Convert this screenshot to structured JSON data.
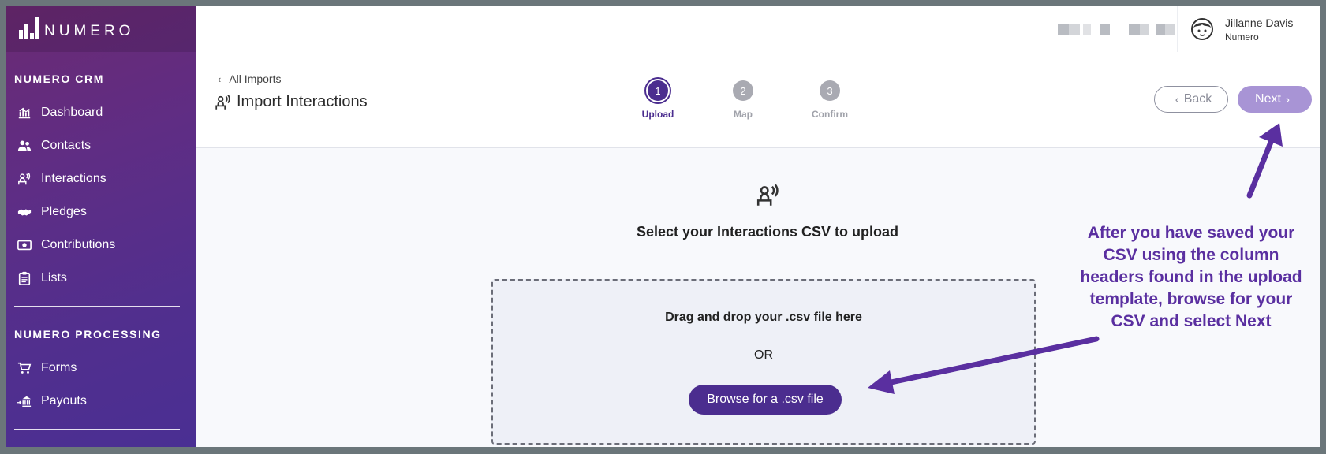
{
  "brand": {
    "name": "NUMERO"
  },
  "sidebar": {
    "section1": "NUMERO CRM",
    "items": [
      {
        "label": "Dashboard",
        "icon": "dashboard-icon"
      },
      {
        "label": "Contacts",
        "icon": "contacts-icon"
      },
      {
        "label": "Interactions",
        "icon": "interactions-icon"
      },
      {
        "label": "Pledges",
        "icon": "handshake-icon"
      },
      {
        "label": "Contributions",
        "icon": "cash-icon"
      },
      {
        "label": "Lists",
        "icon": "clipboard-icon"
      }
    ],
    "section2": "NUMERO PROCESSING",
    "items2": [
      {
        "label": "Forms",
        "icon": "cart-icon"
      },
      {
        "label": "Payouts",
        "icon": "bank-icon"
      }
    ]
  },
  "header": {
    "user_name": "Jillanne Davis",
    "user_org": "Numero"
  },
  "page": {
    "breadcrumb": "All Imports",
    "title": "Import Interactions",
    "steps": [
      {
        "num": "1",
        "label": "Upload",
        "active": true
      },
      {
        "num": "2",
        "label": "Map",
        "active": false
      },
      {
        "num": "3",
        "label": "Confirm",
        "active": false
      }
    ],
    "back_label": "Back",
    "next_label": "Next"
  },
  "upload": {
    "prompt": "Select your Interactions CSV to upload",
    "drag_text": "Drag and drop your .csv file here",
    "or_text": "OR",
    "browse_label": "Browse for a .csv file"
  },
  "annotation": {
    "text": "After you have saved your CSV using the column headers found in the upload template, browse for your CSV and select Next",
    "color": "#5a2fa0"
  },
  "colors": {
    "primary": "#4b2d8f",
    "next_disabled": "#a894d5"
  }
}
